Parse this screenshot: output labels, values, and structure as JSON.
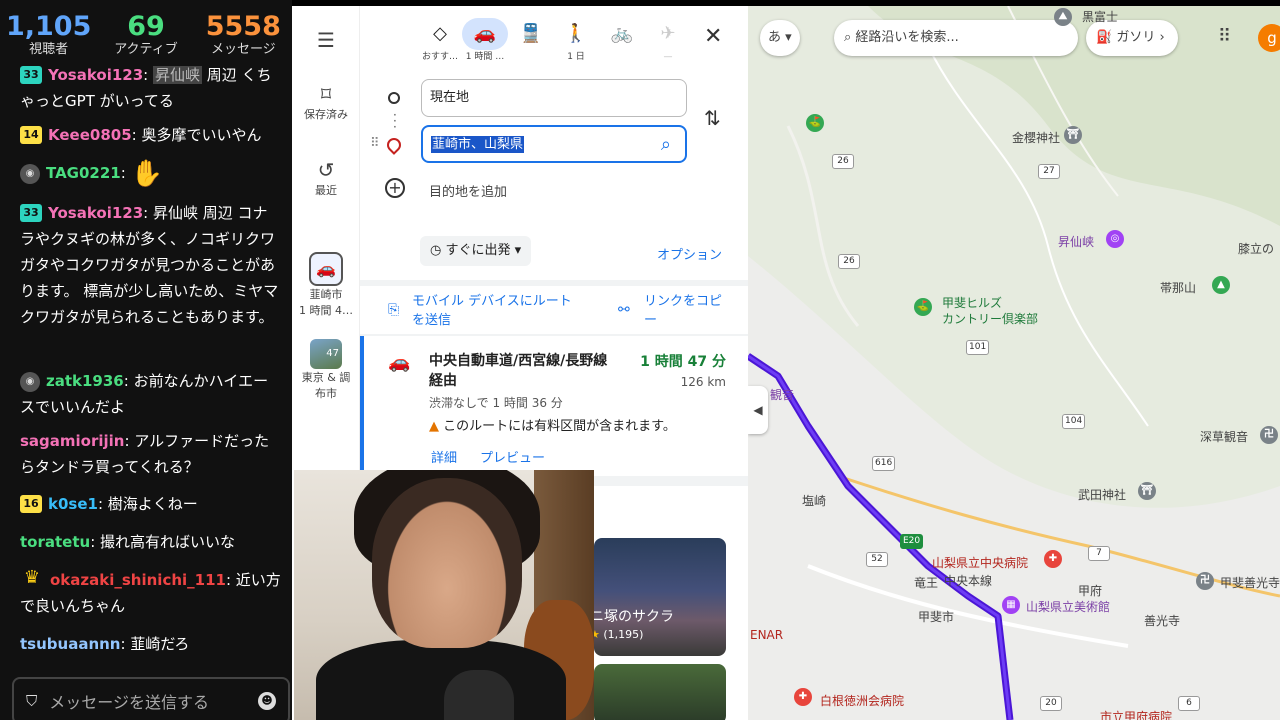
{
  "stats": [
    {
      "value": "1,105",
      "label": "視聴者",
      "color": "#60a5fa"
    },
    {
      "value": "69",
      "label": "アクティブ",
      "color": "#4ade80"
    },
    {
      "value": "5558",
      "label": "メッセージ",
      "color": "#fb923c"
    }
  ],
  "chat": {
    "messages": [
      {
        "user": "Yosakoi123",
        "user_color": "#f472b6",
        "badge": "33",
        "highlight": "昇仙峡",
        "text": "周辺 くちゃっとGPT がいってる"
      },
      {
        "user": "Keee0805",
        "user_color": "#f472b6",
        "badge": "14",
        "text": "奥多摩でいいやん"
      },
      {
        "user": "TAG0221",
        "user_color": "#4ade80",
        "text": ""
      },
      {
        "user": "Yosakoi123",
        "user_color": "#f472b6",
        "badge": "33",
        "text": "昇仙峡 周辺 コナラやクヌギの林が多く、ノコギリクワガタやコクワガタが見つかることがあります。 標高が少し高いため、ミヤマクワガタが見られることもあります。"
      },
      {
        "user": "zatk1936",
        "user_color": "#4ade80",
        "text": "お前なんかハイエースでいいんだよ"
      },
      {
        "user": "sagamiorijin",
        "user_color": "#f472b6",
        "text": "アルファードだったらタンドラ買ってくれる？"
      },
      {
        "user": "k0se1",
        "user_color": "#38bdf8",
        "badge": "16",
        "text": "樹海よくねー"
      },
      {
        "user": "toratetu",
        "user_color": "#4ade80",
        "text": "撮れ高有ればいいな"
      },
      {
        "user": "okazaki_shinichi_111",
        "user_color": "#ef4444",
        "text": "近い方で良いんちゃん"
      },
      {
        "user": "tsubuaannn",
        "user_color": "#93c5fd",
        "text": "韮崎だろ"
      }
    ],
    "input_placeholder": "メッセージを送信する"
  },
  "rail": {
    "saved": "保存済み",
    "recent": "最近",
    "trip1_title": "韮崎市",
    "trip1_sub": "1 時間 4…",
    "trip2_badge": "47",
    "trip2_title": "東京 & 調",
    "trip2_sub": "布市"
  },
  "modes": [
    {
      "icon": "◇",
      "label": "おすす…"
    },
    {
      "icon": "🚗",
      "label": "1 時間 …"
    },
    {
      "icon": "🚆",
      "label": ""
    },
    {
      "icon": "🚶",
      "label": "1 日"
    },
    {
      "icon": "🚲",
      "label": ""
    },
    {
      "icon": "✈",
      "label": "—"
    }
  ],
  "directions": {
    "origin": "現在地",
    "destination": "韮崎市、山梨県",
    "add_destination": "目的地を追加",
    "depart": "すぐに出発",
    "options": "オプション",
    "send_to_mobile": "モバイル デバイスにルートを送信",
    "copy_link": "リンクをコピー"
  },
  "route": {
    "title": "中央自動車道/西宮線/長野線経由",
    "time": "1 時間 47 分",
    "distance": "126 km",
    "no_traffic": "渋滞なしで 1 時間 36 分",
    "warning": "このルートには有料区間が含まれます。",
    "details": "詳細",
    "preview": "プレビュー"
  },
  "explore": {
    "place_title": "ニ塚のサクラ",
    "rating_count": "(1,195)"
  },
  "map_ui": {
    "ime": "あ",
    "search_placeholder": "経路沿いを検索...",
    "gas_chip": "ガソリ",
    "avatar_letter": "g"
  },
  "map_labels": {
    "kurofuji": "黒富士",
    "kanazakura": "金櫻神社",
    "shosenkyo": "昇仙峡",
    "hizanoshiro": "膝立の",
    "obitanayama": "帯那山",
    "golf1": "甲斐ヒルズ",
    "golf2": "カントリー倶楽部",
    "kannon": "観音",
    "fukasawa": "深草観音",
    "takeda": "武田神社",
    "shiozaki": "塩崎",
    "hospital": "山梨県立中央病院",
    "ryuo": "竜王",
    "chuo_line": "中央本線",
    "kofu": "甲府",
    "kaishi": "甲斐市",
    "museum": "山梨県立美術館",
    "zenkoji": "善光寺",
    "kaizenkoji": "甲斐善光寺",
    "shirane": "白根徳洲会病院",
    "kofucity": "市立甲府病院",
    "enar": "ENAR",
    "routes": [
      "26",
      "27",
      "101",
      "104",
      "616",
      "52",
      "E20",
      "20",
      "7",
      "6"
    ]
  },
  "colors": {
    "accent": "#1a73e8",
    "route": "#4b16d6",
    "green": "#188038"
  }
}
